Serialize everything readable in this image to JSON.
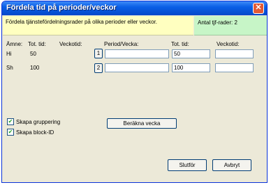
{
  "window": {
    "title": "Fördela tid på perioder/veckor",
    "close_glyph": "✕"
  },
  "info": {
    "description": "Fördela tjänstefördelningsrader på olika perioder eller veckor.",
    "row_count": "Antal tjf-rader: 2"
  },
  "headers": {
    "amne": "Ämne:",
    "tot_tid": "Tot. tid:",
    "veckotid": "Veckotid:",
    "period_vecka": "Period/Vecka:",
    "tot_tid2": "Tot. tid:",
    "veckotid2": "Veckotid:"
  },
  "rows": [
    {
      "amne": "Hi",
      "tot_tid": "50",
      "veckotid": "",
      "button": "1",
      "period": "",
      "tot_tid_value": "50",
      "veckotid_value": ""
    },
    {
      "amne": "Sh",
      "tot_tid": "100",
      "veckotid": "",
      "button": "2",
      "period": "",
      "tot_tid_value": "100",
      "veckotid_value": ""
    }
  ],
  "options": {
    "skapa_gruppering": {
      "label": "Skapa gruppering",
      "checked": true
    },
    "skapa_block_id": {
      "label": "Skapa block-ID",
      "checked": true
    },
    "check_glyph": "✔"
  },
  "buttons": {
    "berakna": "Beräkna vecka",
    "slutfor": "Slutför",
    "avbryt": "Avbryt"
  }
}
